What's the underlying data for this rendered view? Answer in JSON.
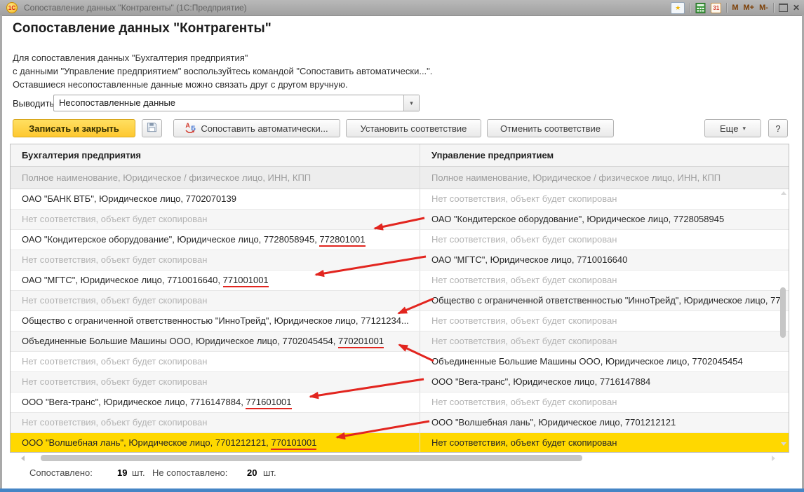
{
  "window": {
    "title": "Сопоставление данных \"Контрагенты\"  (1С:Предприятие)",
    "logo_text": "1С",
    "calendar_day": "31",
    "memory": "M",
    "memory_plus": "M+",
    "memory_minus": "M-"
  },
  "icons": {
    "star": "★",
    "dropdown_arrow": "▾",
    "close": "✕",
    "letter_a": "А",
    "letter_b": "Б"
  },
  "page": {
    "title": "Сопоставление данных \"Контрагенты\"",
    "description": [
      "Для сопоставления данных \"Бухгалтерия предприятия\"",
      "с данными \"Управление предприятием\" воспользуйтесь командой \"Сопоставить автоматически...\".",
      "Оставшиеся несопоставленные данные можно связать друг с другом вручную."
    ],
    "display": {
      "label": "Выводить:",
      "value": "Несопоставленные данные"
    }
  },
  "toolbar": {
    "save_and_close": "Записать и закрыть",
    "match_auto": "Сопоставить автоматически...",
    "set_match": "Установить соответствие",
    "unset_match": "Отменить соответствие",
    "more": "Еще",
    "help": "?"
  },
  "table": {
    "columns": [
      "Бухгалтерия предприятия",
      "Управление предприятием"
    ],
    "subheaders": [
      "Полное наименование, Юридическое / физическое лицо, ИНН, КПП",
      "Полное наименование, Юридическое / физическое лицо, ИНН, КПП"
    ],
    "rows": [
      {
        "left_text": "ОАО \"БАНК ВТБ\", Юридическое лицо, 7702070139",
        "right_text": "Нет соответствия, объект будет скопирован"
      },
      {
        "left_text": "Нет соответствия, объект будет скопирован",
        "right_text": "ОАО \"Кондитерское оборудование\", Юридическое лицо, 7728058945"
      },
      {
        "left_text": "ОАО \"Кондитерское оборудование\", Юридическое лицо, 7728058945, ",
        "left_kpp": "772801001",
        "right_text": "Нет соответствия, объект будет скопирован"
      },
      {
        "left_text": "Нет соответствия, объект будет скопирован",
        "right_text": "ОАО \"МГТС\", Юридическое лицо, 7710016640"
      },
      {
        "left_text": "ОАО \"МГТС\", Юридическое лицо, 7710016640, ",
        "left_kpp": "771001001",
        "right_text": "Нет соответствия, объект будет скопирован"
      },
      {
        "left_text": "Нет соответствия, объект будет скопирован",
        "right_text": "Общество с ограниченной ответственностью \"ИнноТрейд\", Юридическое лицо, 77"
      },
      {
        "left_text": "Общество с ограниченной ответственностью \"ИнноТрейд\", Юридическое лицо, 77121234...",
        "right_text": "Нет соответствия, объект будет скопирован"
      },
      {
        "left_text": "Объединенные Большие Машины ООО, Юридическое лицо, 7702045454, ",
        "left_kpp": "770201001",
        "right_text": "Нет соответствия, объект будет скопирован"
      },
      {
        "left_text": "Нет соответствия, объект будет скопирован",
        "right_text": "Объединенные Большие Машины ООО, Юридическое лицо, 7702045454"
      },
      {
        "left_text": "Нет соответствия, объект будет скопирован",
        "right_text": "ООО \"Вега-транс\", Юридическое лицо, 7716147884"
      },
      {
        "left_text": "ООО \"Вега-транс\", Юридическое лицо, 7716147884, ",
        "left_kpp": "771601001",
        "right_text": "Нет соответствия, объект будет скопирован"
      },
      {
        "left_text": "Нет соответствия, объект будет скопирован",
        "right_text": "ООО \"Волшебная лань\", Юридическое лицо, 7701212121"
      },
      {
        "left_text": "ООО \"Волшебная лань\", Юридическое лицо, 7701212121, ",
        "left_kpp": "770101001",
        "right_text": "Нет соответствия, объект будет скопирован"
      }
    ]
  },
  "footer": {
    "matched_label": "Сопоставлено:",
    "matched_value": "19",
    "matched_unit": "шт.",
    "unmatched_label": "Не сопоставлено:",
    "unmatched_value": "20",
    "unmatched_unit": "шт."
  },
  "colors": {
    "selection_yellow": "#ffd800",
    "annotation_red": "#e2251f",
    "accent_button_yellow": "#fec830"
  }
}
